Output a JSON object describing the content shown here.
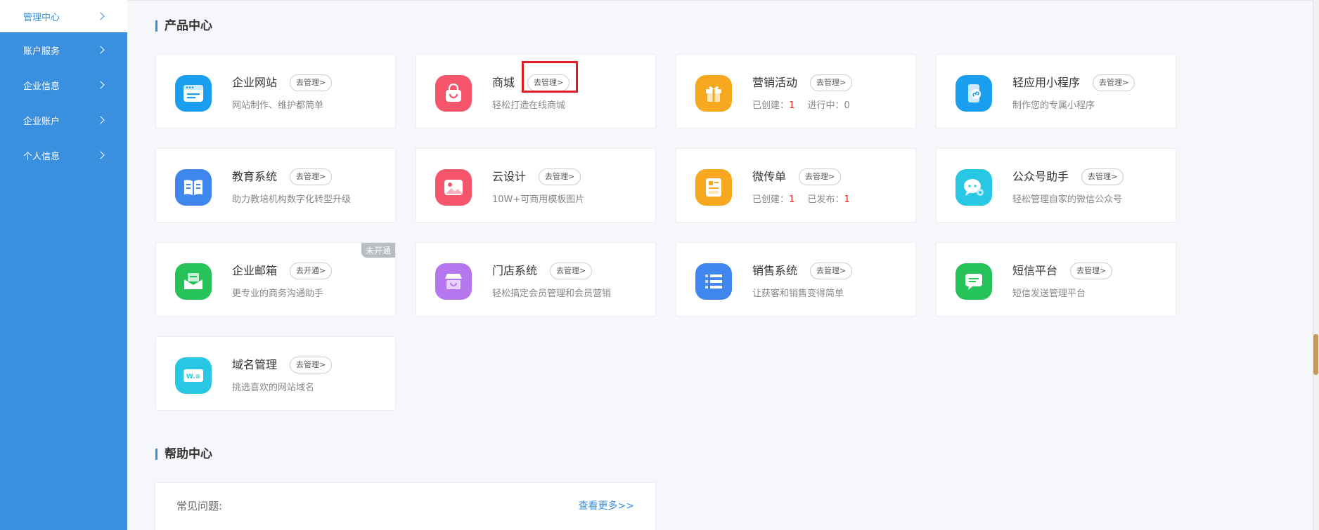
{
  "sidebar": {
    "items": [
      {
        "label": "管理中心",
        "active": true
      },
      {
        "label": "账户服务"
      },
      {
        "label": "企业信息"
      },
      {
        "label": "企业账户"
      },
      {
        "label": "个人信息"
      }
    ]
  },
  "products": {
    "title": "产品中心",
    "cards": [
      {
        "title": "企业网站",
        "button": "去管理>",
        "desc": "网站制作、维护都简单",
        "icon": "website-icon",
        "color": "#1a9ff0"
      },
      {
        "title": "商城",
        "button": "去管理>",
        "desc": "轻松打造在线商城",
        "icon": "shopping-bag-icon",
        "color": "#f5566b"
      },
      {
        "title": "营销活动",
        "button": "去管理>",
        "desc_prefix": "已创建：",
        "desc_value": "1",
        "desc_suffix": "进行中：0",
        "icon": "gift-icon",
        "color": "#f7a81f"
      },
      {
        "title": "轻应用小程序",
        "button": "去管理>",
        "desc": "制作您的专属小程序",
        "icon": "mini-program-icon",
        "color": "#1a9ff0"
      },
      {
        "title": "教育系统",
        "button": "去管理>",
        "desc": "助力教培机构数字化转型升级",
        "icon": "book-icon",
        "color": "#3f86ee"
      },
      {
        "title": "云设计",
        "button": "去管理>",
        "desc": "10W+可商用模板图片",
        "icon": "image-icon",
        "color": "#f5566b"
      },
      {
        "title": "微传单",
        "button": "去管理>",
        "desc_prefix": "已创建：",
        "desc_value": "1",
        "desc_suffix": "已发布：",
        "desc_value2": "1",
        "icon": "flyer-icon",
        "color": "#f7a81f"
      },
      {
        "title": "公众号助手",
        "button": "去管理>",
        "desc": "轻松管理自家的微信公众号",
        "icon": "wechat-icon",
        "color": "#28c8e4"
      },
      {
        "title": "企业邮箱",
        "button": "去开通>",
        "desc": "更专业的商务沟通助手",
        "icon": "mail-icon",
        "color": "#26c35a",
        "badge": "未开通"
      },
      {
        "title": "门店系统",
        "button": "去管理>",
        "desc": "轻松搞定会员管理和会员营销",
        "icon": "store-icon",
        "color": "#b676ee"
      },
      {
        "title": "销售系统",
        "button": "去管理>",
        "desc": "让获客和销售变得简单",
        "icon": "list-icon",
        "color": "#3f86ee"
      },
      {
        "title": "短信平台",
        "button": "去管理>",
        "desc": "短信发送管理平台",
        "icon": "sms-icon",
        "color": "#26c35a"
      },
      {
        "title": "域名管理",
        "button": "去管理>",
        "desc": "挑选喜欢的网站域名",
        "icon": "domain-icon",
        "color": "#28c8e4"
      }
    ]
  },
  "help": {
    "title": "帮助中心",
    "faq_label": "常见问题:",
    "more_label": "查看更多>>"
  }
}
